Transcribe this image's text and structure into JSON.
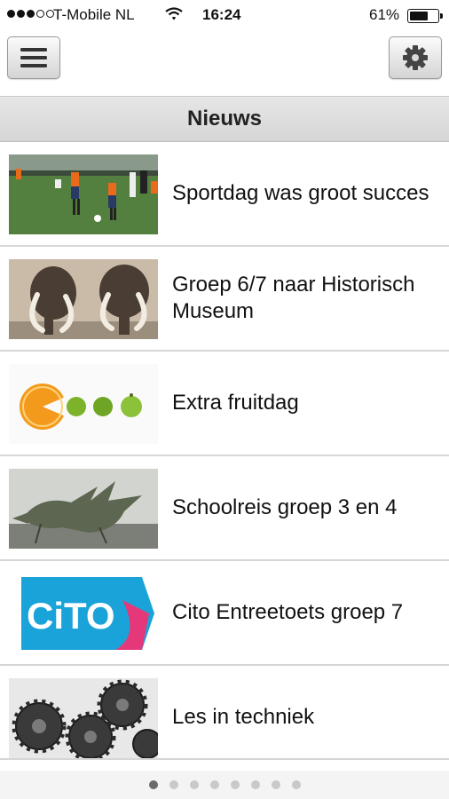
{
  "status_bar": {
    "carrier": "T-Mobile NL",
    "time": "16:24",
    "battery_percent": "61%",
    "battery_level": 0.61,
    "signal_bars": 3
  },
  "toolbar": {
    "menu_icon": "hamburger-menu-icon",
    "settings_icon": "gear-icon"
  },
  "section": {
    "title": "Nieuws"
  },
  "news": [
    {
      "title": "Sportdag was groot succes",
      "thumbnail": "children-playing-football"
    },
    {
      "title": "Groep 6/7 naar Historisch Museum",
      "thumbnail": "mammoth-exhibit"
    },
    {
      "title": "Extra fruitdag",
      "thumbnail": "orange-eating-limes"
    },
    {
      "title": "Schoolreis groep 3 en 4",
      "thumbnail": "dragon-statue"
    },
    {
      "title": "Cito Entreetoets groep 7",
      "thumbnail": "cito-logo",
      "thumbnail_text": "CiTO"
    },
    {
      "title": "Les in techniek",
      "thumbnail": "gears"
    }
  ],
  "pager": {
    "page_count": 8,
    "current_page": 1
  },
  "colors": {
    "header_bg": "#dcdcdc",
    "cito_blue": "#1aa3d9",
    "cito_pink": "#e5387a",
    "orange": "#f39a1c",
    "lime": "#7cb32b"
  }
}
